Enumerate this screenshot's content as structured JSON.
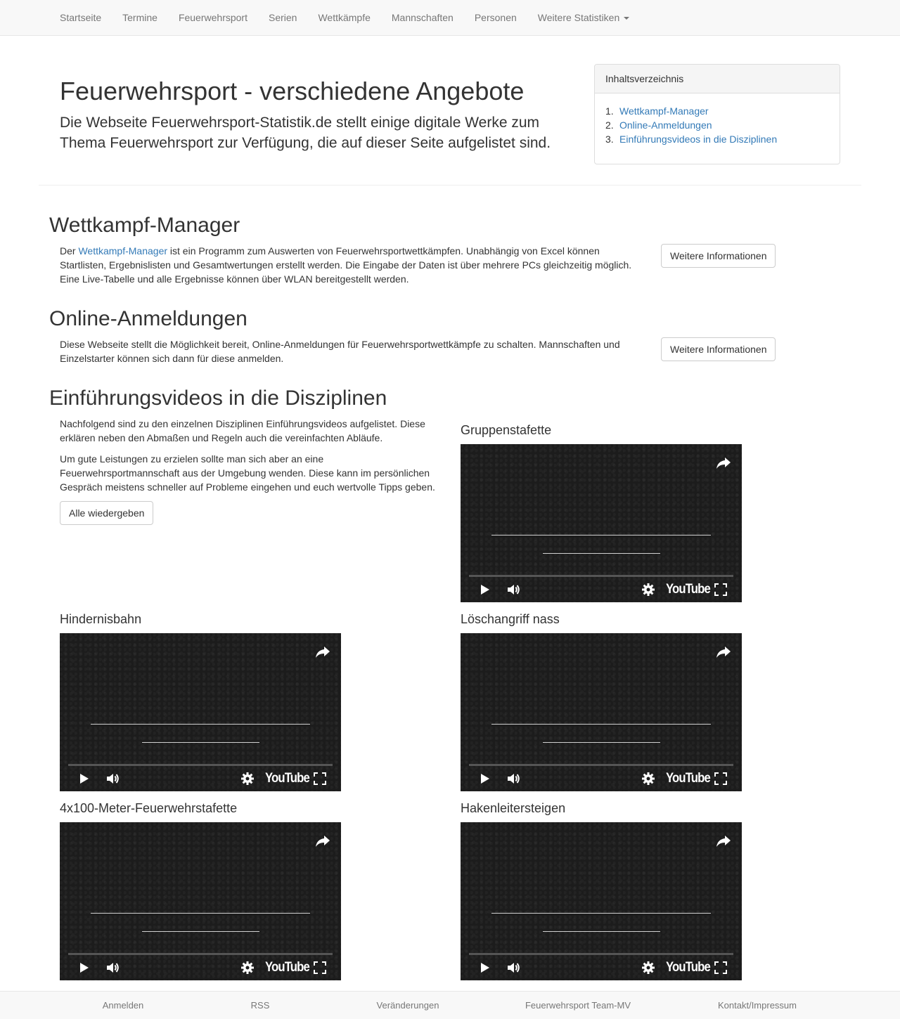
{
  "nav": {
    "items": [
      "Startseite",
      "Termine",
      "Feuerwehrsport",
      "Serien",
      "Wettkämpfe",
      "Mannschaften",
      "Personen"
    ],
    "dropdown": "Weitere Statistiken"
  },
  "hero": {
    "title": "Feuerwehrsport - verschiedene Angebote",
    "lead": "Die Webseite Feuerwehrsport-Statistik.de stellt einige digitale Werke zum Thema Feuerwehrsport zur Verfügung, die auf dieser Seite aufgelistet sind."
  },
  "toc": {
    "heading": "Inhaltsverzeichnis",
    "items": [
      {
        "num": "1.",
        "label": "Wettkampf-Manager"
      },
      {
        "num": "2.",
        "label": "Online-Anmeldungen"
      },
      {
        "num": "3.",
        "label": "Einführungsvideos in die Disziplinen"
      }
    ]
  },
  "wettkampf": {
    "heading": "Wettkampf-Manager",
    "text_before": "Der ",
    "link": "Wettkampf-Manager",
    "text_after": " ist ein Programm zum Auswerten von Feuerwehrsportwettkämpfen. Unabhängig von Excel können Startlisten, Ergebnislisten und Gesamtwertungen erstellt werden. Die Eingabe der Daten ist über mehrere PCs gleichzeitig möglich. Eine Live-Tabelle und alle Ergebnisse können über WLAN bereitgestellt werden.",
    "button": "Weitere Informationen"
  },
  "online": {
    "heading": "Online-Anmeldungen",
    "text": "Diese Webseite stellt die Möglichkeit bereit, Online-Anmeldungen für Feuerwehrsportwettkämpfe zu schalten. Mannschaften und Einzelstarter können sich dann für diese anmelden.",
    "button": "Weitere Informationen"
  },
  "videos": {
    "heading": "Einführungsvideos in die Disziplinen",
    "p1": "Nachfolgend sind zu den einzelnen Disziplinen Einführungsvideos aufgelistet. Diese erklären neben den Abmaßen und Regeln auch die vereinfachten Abläufe.",
    "p2": "Um gute Leistungen zu erzielen sollte man sich aber an eine Feuerwehrsportmannschaft aus der Umgebung wenden. Diese kann im persönlichen Gespräch meistens schneller auf Probleme eingehen und euch wertvolle Tipps geben.",
    "play_all": "Alle wiedergeben",
    "player_brand": "YouTube",
    "items": [
      "Gruppenstafette",
      "Hindernisbahn",
      "Löschangriff nass",
      "4x100-Meter-Feuerwehrstafette",
      "Hakenleitersteigen"
    ]
  },
  "footer": {
    "items": [
      "Anmelden",
      "RSS",
      "Veränderungen",
      "Feuerwehrsport Team-MV",
      "Kontakt/Impressum"
    ]
  }
}
